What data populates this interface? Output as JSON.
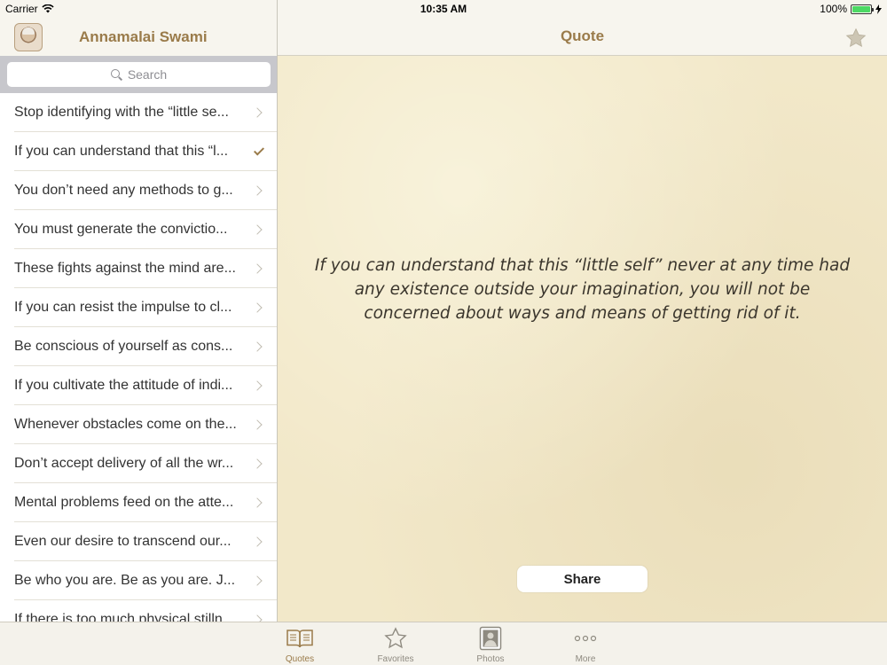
{
  "status_bar": {
    "carrier": "Carrier",
    "time": "10:35 AM",
    "battery": "100%"
  },
  "master": {
    "title": "Annamalai Swami",
    "search_placeholder": "Search",
    "items": [
      {
        "label": "Stop identifying with the “little se...",
        "accessory": "chevron"
      },
      {
        "label": "If you can understand that this “l...",
        "accessory": "check"
      },
      {
        "label": "You don’t need any methods to g...",
        "accessory": "chevron"
      },
      {
        "label": "You must generate the convictio...",
        "accessory": "chevron"
      },
      {
        "label": "These fights against the mind are...",
        "accessory": "chevron"
      },
      {
        "label": "If you can resist the impulse to cl...",
        "accessory": "chevron"
      },
      {
        "label": "Be conscious of yourself as cons...",
        "accessory": "chevron"
      },
      {
        "label": "If you cultivate the attitude of indi...",
        "accessory": "chevron"
      },
      {
        "label": "Whenever obstacles come on the...",
        "accessory": "chevron"
      },
      {
        "label": "Don’t accept delivery of all the wr...",
        "accessory": "chevron"
      },
      {
        "label": "Mental problems feed on the atte...",
        "accessory": "chevron"
      },
      {
        "label": "Even our desire to transcend our...",
        "accessory": "chevron"
      },
      {
        "label": "Be who you are. Be as you are. J...",
        "accessory": "chevron"
      },
      {
        "label": "If there is too much physical stilln...",
        "accessory": "chevron"
      }
    ]
  },
  "detail": {
    "title": "Quote",
    "quote": "If you can understand that this “little self” never at any time had any existence outside your imagination, you will not be concerned about ways and means of getting rid of it.",
    "share_label": "Share"
  },
  "tabs": [
    {
      "label": "Quotes",
      "icon": "book-icon",
      "active": true
    },
    {
      "label": "Favorites",
      "icon": "star-icon",
      "active": false
    },
    {
      "label": "Photos",
      "icon": "photo-icon",
      "active": false
    },
    {
      "label": "More",
      "icon": "more-icon",
      "active": false
    }
  ],
  "colors": {
    "accent": "#9a7b4a",
    "paper": "#f2e8c9",
    "battery": "#4cd964"
  }
}
